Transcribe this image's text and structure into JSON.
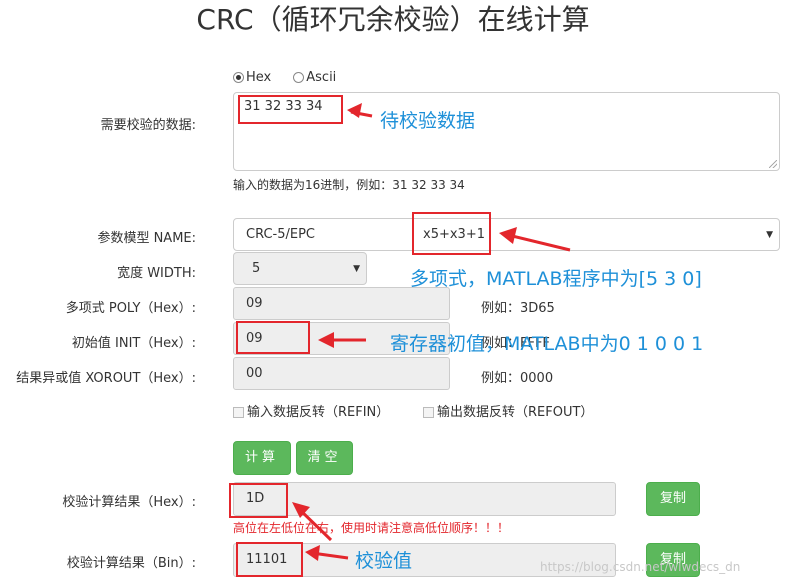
{
  "page_title": "CRC（循环冗余校验）在线计算",
  "format_radios": [
    {
      "label": "Hex",
      "checked": true
    },
    {
      "label": "Ascii",
      "checked": false
    }
  ],
  "data_input": {
    "label": "需要校验的数据:",
    "value": "31 32 33 34",
    "help": "输入的数据为16进制，例如：31 32 33 34"
  },
  "model": {
    "label": "参数模型 NAME:",
    "value": "CRC-5/EPC",
    "poly_text": "x5+x3+1"
  },
  "width": {
    "label": "宽度 WIDTH:",
    "value": "5"
  },
  "poly": {
    "label": "多项式 POLY（Hex）:",
    "value": "09",
    "example": "例如：3D65"
  },
  "init": {
    "label": "初始值 INIT（Hex）:",
    "value": "09",
    "example": "例如：FFFF"
  },
  "xorout": {
    "label": "结果异或值 XOROUT（Hex）:",
    "value": "00",
    "example": "例如：0000"
  },
  "refin": {
    "label": "输入数据反转（REFIN）"
  },
  "refout": {
    "label": "输出数据反转（REFOUT）"
  },
  "buttons": {
    "calc": "计算",
    "clear": "清空",
    "copy": "复制"
  },
  "result_hex": {
    "label": "校验计算结果（Hex）:",
    "value": "1D"
  },
  "warning": "高位在左低位在右，使用时请注意高低位顺序！！！",
  "result_bin": {
    "label": "校验计算结果（Bin）:",
    "value": "11101"
  },
  "annotations": {
    "data": "待校验数据",
    "poly": "多项式，MATLAB程序中为[5 3 0]",
    "init": "寄存器初值，MATLAB中为0 1 0 0 1",
    "check": "校验值"
  },
  "watermark": "https://blog.csdn.net/wlwdecs_dn",
  "colors": {
    "button": "#5cb85c",
    "annotation": "#1e90d8",
    "highlight": "#e3262c"
  },
  "icons": [
    "dropdown-caret-icon",
    "red-arrow-icon"
  ]
}
